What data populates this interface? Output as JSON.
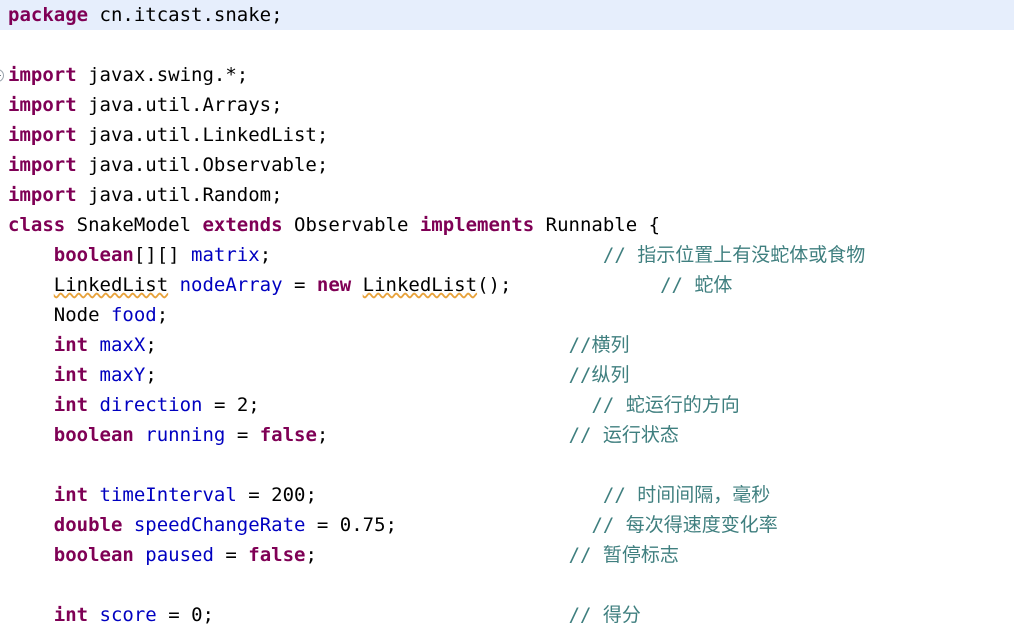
{
  "editor": {
    "language": "Java",
    "colors": {
      "background": "#ffffff",
      "keyword": "#7f0055",
      "field": "#0000c0",
      "comment": "#3f7f7f",
      "plain": "#000000",
      "current_line_highlight": "#e6eefc",
      "warning_squiggle": "#e8a33d",
      "fold_marker": "#9aa4ad"
    },
    "current_line_index": 0,
    "fold_marker_line_index": 2,
    "fold_marker_icon": "collapse-minus-circle-icon"
  },
  "lines": [
    {
      "id": "line-1",
      "highlight": true,
      "fold": false,
      "tokens": [
        {
          "t": "package",
          "c": "kw"
        },
        {
          "t": " cn.itcast.snake;",
          "c": "plain"
        }
      ]
    },
    {
      "id": "line-2",
      "highlight": false,
      "fold": false,
      "tokens": []
    },
    {
      "id": "line-3",
      "highlight": false,
      "fold": true,
      "tokens": [
        {
          "t": "import",
          "c": "kw"
        },
        {
          "t": " javax.swing.*;",
          "c": "plain"
        }
      ]
    },
    {
      "id": "line-4",
      "highlight": false,
      "fold": false,
      "tokens": [
        {
          "t": "import",
          "c": "kw"
        },
        {
          "t": " java.util.Arrays;",
          "c": "plain"
        }
      ]
    },
    {
      "id": "line-5",
      "highlight": false,
      "fold": false,
      "tokens": [
        {
          "t": "import",
          "c": "kw"
        },
        {
          "t": " java.util.LinkedList;",
          "c": "plain"
        }
      ]
    },
    {
      "id": "line-6",
      "highlight": false,
      "fold": false,
      "tokens": [
        {
          "t": "import",
          "c": "kw"
        },
        {
          "t": " java.util.Observable;",
          "c": "plain"
        }
      ]
    },
    {
      "id": "line-7",
      "highlight": false,
      "fold": false,
      "tokens": [
        {
          "t": "import",
          "c": "kw"
        },
        {
          "t": " java.util.Random;",
          "c": "plain"
        }
      ]
    },
    {
      "id": "line-8",
      "highlight": false,
      "fold": false,
      "tokens": [
        {
          "t": "class",
          "c": "kw"
        },
        {
          "t": " SnakeModel ",
          "c": "plain"
        },
        {
          "t": "extends",
          "c": "kw"
        },
        {
          "t": " Observable ",
          "c": "plain"
        },
        {
          "t": "implements",
          "c": "kw"
        },
        {
          "t": " Runnable {",
          "c": "plain"
        }
      ]
    },
    {
      "id": "line-9",
      "highlight": false,
      "fold": false,
      "tokens": [
        {
          "t": "    ",
          "c": "plain"
        },
        {
          "t": "boolean",
          "c": "kw"
        },
        {
          "t": "[][] ",
          "c": "plain"
        },
        {
          "t": "matrix",
          "c": "fld"
        },
        {
          "t": ";",
          "c": "plain"
        },
        {
          "t": "                             ",
          "c": "plain"
        },
        {
          "t": "// 指示位置上有没蛇体或食物",
          "c": "cmt"
        }
      ]
    },
    {
      "id": "line-10",
      "highlight": false,
      "fold": false,
      "tokens": [
        {
          "t": "    ",
          "c": "plain"
        },
        {
          "t": "LinkedList",
          "c": "warn"
        },
        {
          "t": " ",
          "c": "plain"
        },
        {
          "t": "nodeArray",
          "c": "fld"
        },
        {
          "t": " = ",
          "c": "plain"
        },
        {
          "t": "new",
          "c": "kw"
        },
        {
          "t": " ",
          "c": "plain"
        },
        {
          "t": "LinkedList",
          "c": "warn"
        },
        {
          "t": "();",
          "c": "plain"
        },
        {
          "t": "             ",
          "c": "plain"
        },
        {
          "t": "// 蛇体",
          "c": "cmt"
        }
      ]
    },
    {
      "id": "line-11",
      "highlight": false,
      "fold": false,
      "tokens": [
        {
          "t": "    Node ",
          "c": "plain"
        },
        {
          "t": "food",
          "c": "fld"
        },
        {
          "t": ";",
          "c": "plain"
        }
      ]
    },
    {
      "id": "line-12",
      "highlight": false,
      "fold": false,
      "tokens": [
        {
          "t": "    ",
          "c": "plain"
        },
        {
          "t": "int",
          "c": "kw"
        },
        {
          "t": " ",
          "c": "plain"
        },
        {
          "t": "maxX",
          "c": "fld"
        },
        {
          "t": ";",
          "c": "plain"
        },
        {
          "t": "                                    ",
          "c": "plain"
        },
        {
          "t": "//横列",
          "c": "cmt"
        }
      ]
    },
    {
      "id": "line-13",
      "highlight": false,
      "fold": false,
      "tokens": [
        {
          "t": "    ",
          "c": "plain"
        },
        {
          "t": "int",
          "c": "kw"
        },
        {
          "t": " ",
          "c": "plain"
        },
        {
          "t": "maxY",
          "c": "fld"
        },
        {
          "t": ";",
          "c": "plain"
        },
        {
          "t": "                                    ",
          "c": "plain"
        },
        {
          "t": "//纵列",
          "c": "cmt"
        }
      ]
    },
    {
      "id": "line-14",
      "highlight": false,
      "fold": false,
      "tokens": [
        {
          "t": "    ",
          "c": "plain"
        },
        {
          "t": "int",
          "c": "kw"
        },
        {
          "t": " ",
          "c": "plain"
        },
        {
          "t": "direction",
          "c": "fld"
        },
        {
          "t": " = ",
          "c": "plain"
        },
        {
          "t": "2",
          "c": "num"
        },
        {
          "t": ";",
          "c": "plain"
        },
        {
          "t": "                             ",
          "c": "plain"
        },
        {
          "t": "// 蛇运行的方向",
          "c": "cmt"
        }
      ]
    },
    {
      "id": "line-15",
      "highlight": false,
      "fold": false,
      "tokens": [
        {
          "t": "    ",
          "c": "plain"
        },
        {
          "t": "boolean",
          "c": "kw"
        },
        {
          "t": " ",
          "c": "plain"
        },
        {
          "t": "running",
          "c": "fld"
        },
        {
          "t": " = ",
          "c": "plain"
        },
        {
          "t": "false",
          "c": "kw"
        },
        {
          "t": ";",
          "c": "plain"
        },
        {
          "t": "                     ",
          "c": "plain"
        },
        {
          "t": "// 运行状态",
          "c": "cmt"
        }
      ]
    },
    {
      "id": "line-16",
      "highlight": false,
      "fold": false,
      "tokens": []
    },
    {
      "id": "line-17",
      "highlight": false,
      "fold": false,
      "tokens": [
        {
          "t": "    ",
          "c": "plain"
        },
        {
          "t": "int",
          "c": "kw"
        },
        {
          "t": " ",
          "c": "plain"
        },
        {
          "t": "timeInterval",
          "c": "fld"
        },
        {
          "t": " = ",
          "c": "plain"
        },
        {
          "t": "200",
          "c": "num"
        },
        {
          "t": ";",
          "c": "plain"
        },
        {
          "t": "                         ",
          "c": "plain"
        },
        {
          "t": "// 时间间隔，毫秒",
          "c": "cmt"
        }
      ]
    },
    {
      "id": "line-18",
      "highlight": false,
      "fold": false,
      "tokens": [
        {
          "t": "    ",
          "c": "plain"
        },
        {
          "t": "double",
          "c": "kw"
        },
        {
          "t": " ",
          "c": "plain"
        },
        {
          "t": "speedChangeRate",
          "c": "fld"
        },
        {
          "t": " = ",
          "c": "plain"
        },
        {
          "t": "0.75",
          "c": "num"
        },
        {
          "t": ";",
          "c": "plain"
        },
        {
          "t": "                 ",
          "c": "plain"
        },
        {
          "t": "// 每次得速度变化率",
          "c": "cmt"
        }
      ]
    },
    {
      "id": "line-19",
      "highlight": false,
      "fold": false,
      "tokens": [
        {
          "t": "    ",
          "c": "plain"
        },
        {
          "t": "boolean",
          "c": "kw"
        },
        {
          "t": " ",
          "c": "plain"
        },
        {
          "t": "paused",
          "c": "fld"
        },
        {
          "t": " = ",
          "c": "plain"
        },
        {
          "t": "false",
          "c": "kw"
        },
        {
          "t": ";",
          "c": "plain"
        },
        {
          "t": "                      ",
          "c": "plain"
        },
        {
          "t": "// 暂停标志",
          "c": "cmt"
        }
      ]
    },
    {
      "id": "line-20",
      "highlight": false,
      "fold": false,
      "tokens": []
    },
    {
      "id": "line-21",
      "highlight": false,
      "fold": false,
      "tokens": [
        {
          "t": "    ",
          "c": "plain"
        },
        {
          "t": "int",
          "c": "kw"
        },
        {
          "t": " ",
          "c": "plain"
        },
        {
          "t": "score",
          "c": "fld"
        },
        {
          "t": " = ",
          "c": "plain"
        },
        {
          "t": "0",
          "c": "num"
        },
        {
          "t": ";",
          "c": "plain"
        },
        {
          "t": "                               ",
          "c": "plain"
        },
        {
          "t": "// 得分",
          "c": "cmt"
        }
      ]
    }
  ]
}
